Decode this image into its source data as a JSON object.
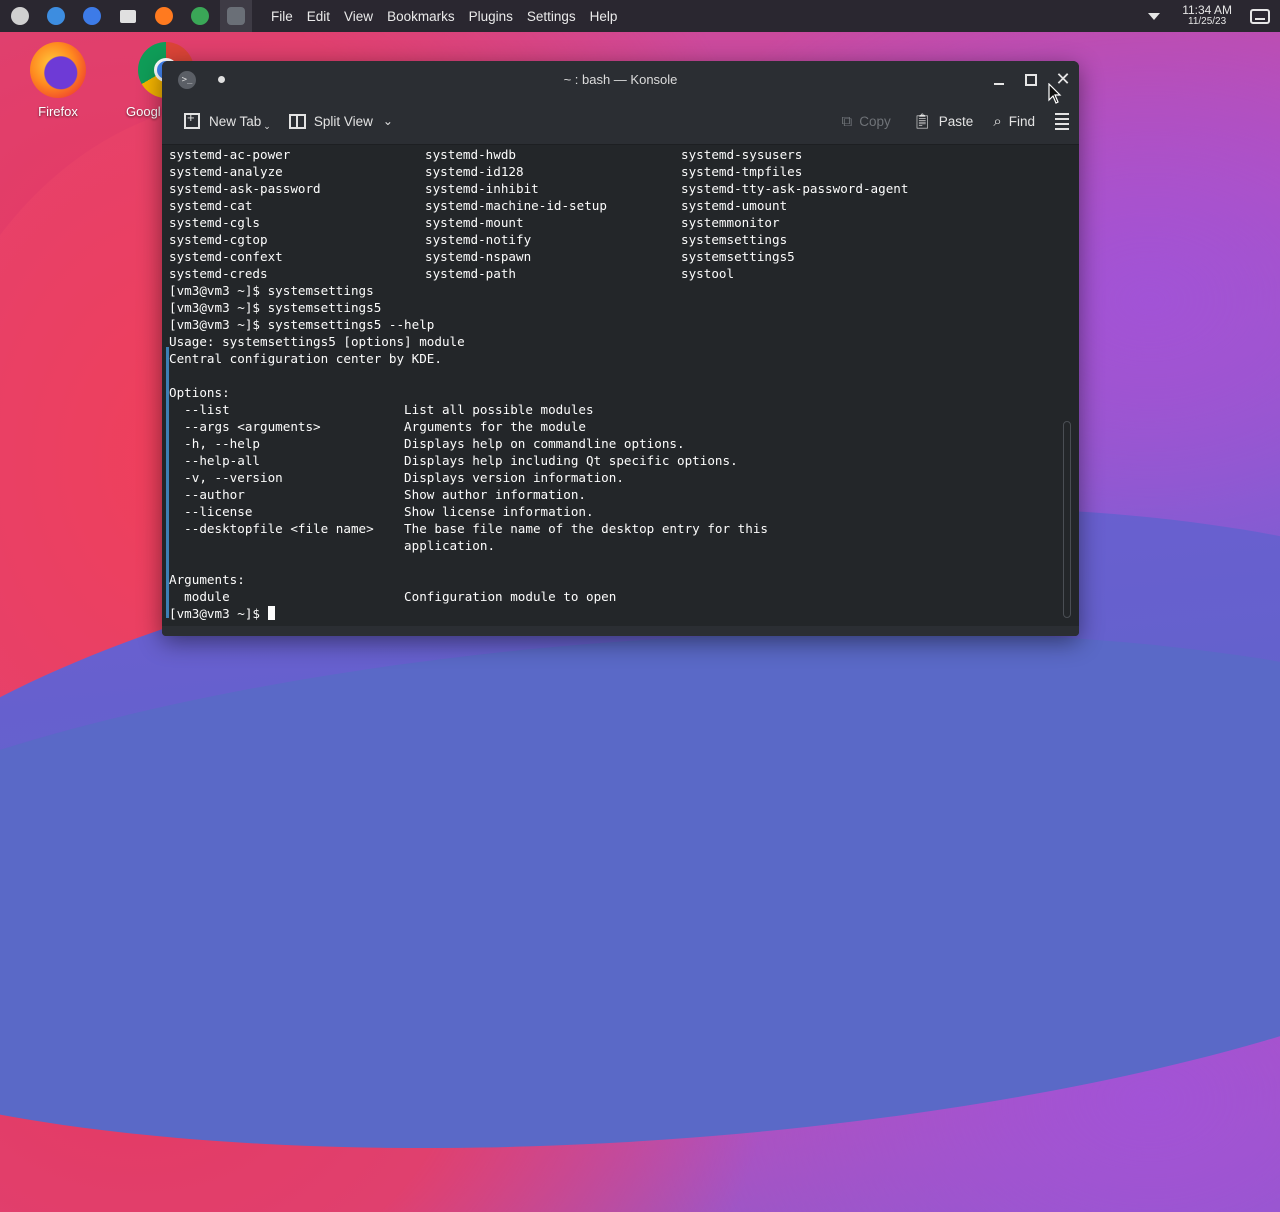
{
  "panel": {
    "launchers": [
      {
        "name": "app-launcher-icon",
        "color": "#d0d0d0"
      },
      {
        "name": "discover-icon",
        "color": "#3d8de0"
      },
      {
        "name": "settings-icon",
        "color": "#3d7be8"
      },
      {
        "name": "files-icon",
        "color": "#e0e0e0"
      },
      {
        "name": "firefox-icon",
        "color": "#ff7a1f"
      },
      {
        "name": "chrome-icon",
        "color": "#3aa757"
      },
      {
        "name": "konsole-icon",
        "color": "#6a6f77"
      }
    ],
    "menu": [
      "File",
      "Edit",
      "View",
      "Bookmarks",
      "Plugins",
      "Settings",
      "Help"
    ],
    "clock_time": "11:34 AM",
    "clock_date": "11/25/23"
  },
  "desktop": {
    "icons": [
      {
        "label": "Firefox"
      },
      {
        "label": "Googl"
      }
    ]
  },
  "window": {
    "title": "~ : bash — Konsole",
    "toolbar": {
      "new_tab": "New Tab",
      "split_view": "Split View",
      "copy": "Copy",
      "paste": "Paste",
      "find": "Find"
    },
    "terminal": {
      "columns": [
        [
          "systemd-ac-power",
          "systemd-hwdb",
          "systemd-sysusers"
        ],
        [
          "systemd-analyze",
          "systemd-id128",
          "systemd-tmpfiles"
        ],
        [
          "systemd-ask-password",
          "systemd-inhibit",
          "systemd-tty-ask-password-agent"
        ],
        [
          "systemd-cat",
          "systemd-machine-id-setup",
          "systemd-umount"
        ],
        [
          "systemd-cgls",
          "systemd-mount",
          "systemmonitor"
        ],
        [
          "systemd-cgtop",
          "systemd-notify",
          "systemsettings"
        ],
        [
          "systemd-confext",
          "systemd-nspawn",
          "systemsettings5"
        ],
        [
          "systemd-creds",
          "systemd-path",
          "systool"
        ]
      ],
      "lines": [
        "[vm3@vm3 ~]$ systemsettings",
        "[vm3@vm3 ~]$ systemsettings5",
        "[vm3@vm3 ~]$ systemsettings5 --help",
        "Usage: systemsettings5 [options] module",
        "Central configuration center by KDE.",
        "",
        "Options:",
        "  --list                       List all possible modules",
        "  --args <arguments>           Arguments for the module",
        "  -h, --help                   Displays help on commandline options.",
        "  --help-all                   Displays help including Qt specific options.",
        "  -v, --version                Displays version information.",
        "  --author                     Show author information.",
        "  --license                    Show license information.",
        "  --desktopfile <file name>    The base file name of the desktop entry for this",
        "                               application.",
        "",
        "Arguments:",
        "  module                       Configuration module to open"
      ],
      "prompt": "[vm3@vm3 ~]$ "
    }
  }
}
